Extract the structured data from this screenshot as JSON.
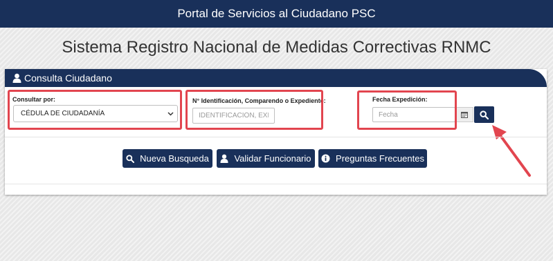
{
  "header": {
    "title": "Portal de Servicios al Ciudadano PSC"
  },
  "page": {
    "title": "Sistema Registro Nacional de Medidas Correctivas RNMC"
  },
  "panel": {
    "title": "Consulta Ciudadano",
    "icon": "user-icon"
  },
  "form": {
    "consultar_label": "Consultar por:",
    "consultar_value": "CÉDULA DE CIUDADANÍA",
    "identificacion_label": "N° Identificación, Comparendo o Expediente:",
    "identificacion_placeholder": "IDENTIFICACIÓN, EXPE",
    "fecha_label": "Fecha Expedición:",
    "fecha_placeholder": "Fecha"
  },
  "buttons": {
    "nueva_busqueda": "Nueva Busqueda",
    "validar_funcionario": "Validar Funcionario",
    "preguntas_frecuentes": "Preguntas Frecuentes"
  },
  "icons": [
    "user-icon",
    "calendar-icon",
    "search-icon",
    "info-icon",
    "chevron-down-icon",
    "arrow-annotation"
  ],
  "colors": {
    "brand": "#19305a",
    "highlight": "#e2454f",
    "background": "#ececec"
  }
}
